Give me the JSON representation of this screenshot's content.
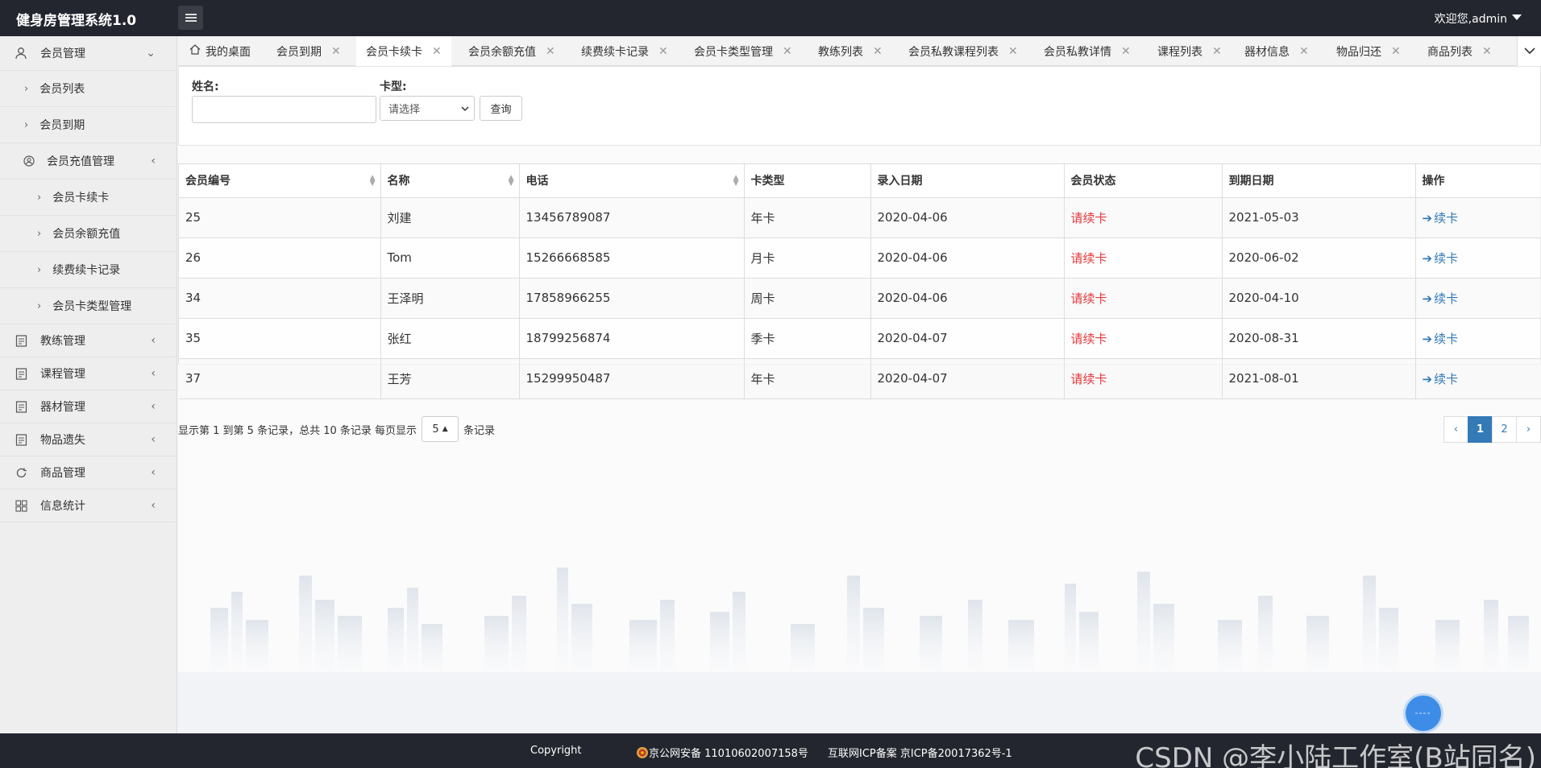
{
  "header": {
    "title": "健身房管理系统1.0",
    "welcome": "欢迎您,admin"
  },
  "sidebar": {
    "member_mgmt": "会员管理",
    "member_list": "会员列表",
    "member_expire": "会员到期",
    "recharge_mgmt": "会员充值管理",
    "card_renew": "会员卡续卡",
    "balance_recharge": "会员余额充值",
    "renew_records": "续费续卡记录",
    "card_type_mgmt": "会员卡类型管理",
    "coach_mgmt": "教练管理",
    "course_mgmt": "课程管理",
    "equipment_mgmt": "器材管理",
    "lost_items": "物品遗失",
    "product_mgmt": "商品管理",
    "statistics": "信息统计"
  },
  "tabs": [
    "我的桌面",
    "会员到期",
    "会员卡续卡",
    "会员余额充值",
    "续费续卡记录",
    "会员卡类型管理",
    "教练列表",
    "会员私教课程列表",
    "会员私教详情",
    "课程列表",
    "器材信息",
    "物品归还",
    "商品列表"
  ],
  "search": {
    "name_label": "姓名:",
    "card_label": "卡型:",
    "select_placeholder": "请选择",
    "query_button": "查询"
  },
  "table": {
    "headers": [
      "会员编号",
      "名称",
      "电话",
      "卡类型",
      "录入日期",
      "会员状态",
      "到期日期",
      "操作"
    ],
    "rows": [
      [
        "25",
        "刘建",
        "13456789087",
        "年卡",
        "2020-04-06",
        "请续卡",
        "2021-05-03",
        "续卡"
      ],
      [
        "26",
        "Tom",
        "15266668585",
        "月卡",
        "2020-04-06",
        "请续卡",
        "2020-06-02",
        "续卡"
      ],
      [
        "34",
        "王泽明",
        "17858966255",
        "周卡",
        "2020-04-06",
        "请续卡",
        "2020-04-10",
        "续卡"
      ],
      [
        "35",
        "张红",
        "18799256874",
        "季卡",
        "2020-04-07",
        "请续卡",
        "2020-08-31",
        "续卡"
      ],
      [
        "37",
        "王芳",
        "15299950487",
        "年卡",
        "2020-04-07",
        "请续卡",
        "2021-08-01",
        "续卡"
      ]
    ]
  },
  "pager": {
    "info": "显示第 1 到第 5 条记录，总共 10 条记录 每页显示",
    "page_size": "5",
    "suffix": "条记录",
    "prev": "‹",
    "pages": [
      "1",
      "2"
    ],
    "next": "›"
  },
  "footer": {
    "copyright": "Copyright",
    "police": "京公网安备 11010602007158号",
    "icp": "互联网ICP备案 京ICP备20017362号-1",
    "watermark": "CSDN @李小陆工作室(B站同名)"
  },
  "colors": {
    "topbar": "#23262e",
    "link": "#337ab7",
    "status": "#e4393c",
    "sidebar": "#eeeeee"
  }
}
